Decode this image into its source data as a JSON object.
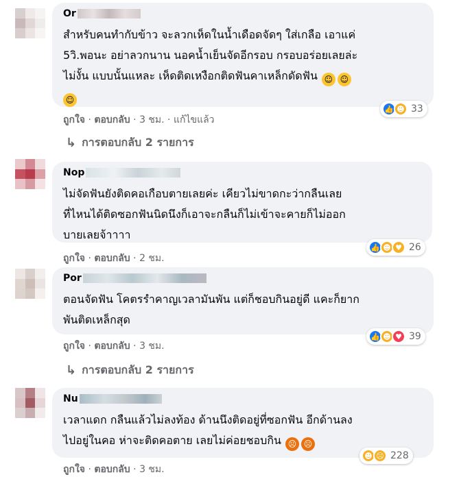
{
  "comments": [
    {
      "name": "Or",
      "lines": [
        "สำหรับคนทำกับข้าว จะลวกเห็ดในน้ำเดือดจัดๆ ใส่เกลือ เอาแค่",
        "5วิ.พอนะ อย่าลวกนาน นอคน้ำเย็นจัดอีกรอบ กรอบอร่อยเลยล่ะ",
        "ไม่งั้น แบบนั้นแหละ เห็ดติดเหงือกติดฟันคาเหล็กดัดฟัน"
      ],
      "emoji": [
        "grinning-face-emoji",
        "grinning-face-emoji",
        "grinning-sweat-emoji"
      ],
      "reaction_count": "33",
      "reactions": [
        "like",
        "haha"
      ],
      "actions": [
        "ถูกใจ",
        "ตอบกลับ",
        "3 ชม.",
        "แก้ไขแล้ว"
      ],
      "replies": "การตอบกลับ 2 รายการ"
    },
    {
      "name": "Nop",
      "lines": [
        "ไม่จัดฟันยังติดคอเกือบตายเลยค่ะ เคียวไม่ขาดกะว่ากลืนเลย",
        "ที่ไหนได้ติดซอกฟันนิดนึงก็เอาจะกลืนก็ไม่เข้าจะคายก็ไม่ออก",
        "บายเลยจ้าาาา"
      ],
      "reaction_count": "26",
      "reactions": [
        "like",
        "haha",
        "care"
      ],
      "actions": [
        "ถูกใจ",
        "ตอบกลับ",
        "2 ชม."
      ]
    },
    {
      "name": "Por",
      "lines": [
        "ตอนจัดฟัน โคตรรำคาญเวลามันพัน แต่ก็ชอบกินอยู่ดี แคะก็ยาก",
        "พันติดเหล็กสุด"
      ],
      "reaction_count": "39",
      "reactions": [
        "like",
        "haha",
        "love"
      ],
      "actions": [
        "ถูกใจ",
        "ตอบกลับ",
        "3 ชม."
      ],
      "replies": "การตอบกลับ 2 รายการ"
    },
    {
      "name": "Nu",
      "lines": [
        "เวลาแดก กลืนแล้วไม่ลงท้อง ด้านนึงติดอยู่ที่ซอกฟัน อีกด้านลง",
        "ไปอยู่ในคอ ห่าจะติดคอตาย เลยไม่ค่อยชอบกิน"
      ],
      "emoji": [
        "angry-face-emoji",
        "angry-face-emoji"
      ],
      "reaction_count": "228",
      "reactions": [
        "haha",
        "sad"
      ],
      "actions": [
        "ถูกใจ",
        "ตอบกลับ",
        "3 ชม."
      ]
    }
  ],
  "colors": {
    "bubble": "#f0f2f5",
    "like": "#1877f2",
    "haha": "#f7b125",
    "love": "#f33e58",
    "angry": "#e9710f",
    "secondary_text": "#65676b"
  }
}
